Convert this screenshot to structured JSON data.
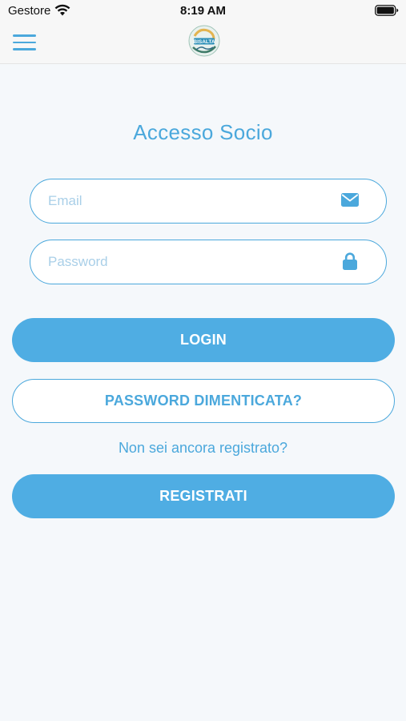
{
  "status_bar": {
    "carrier": "Gestore",
    "time": "8:19 AM"
  },
  "nav": {
    "menu_icon": "hamburger-icon",
    "logo": "app-logo",
    "logo_text": "BISALTA"
  },
  "login": {
    "title": "Accesso Socio",
    "email_placeholder": "Email",
    "email_value": "",
    "email_icon": "envelope-icon",
    "password_placeholder": "Password",
    "password_value": "",
    "password_icon": "lock-icon",
    "login_label": "LOGIN",
    "forgot_label": "PASSWORD DIMENTICATA?",
    "register_prompt": "Non sei ancora registrato?",
    "register_label": "REGISTRATI"
  },
  "colors": {
    "accent": "#4ba8dc",
    "button_fill": "#4fade3",
    "background": "#f5f8fb",
    "placeholder": "#a9cfe8"
  }
}
